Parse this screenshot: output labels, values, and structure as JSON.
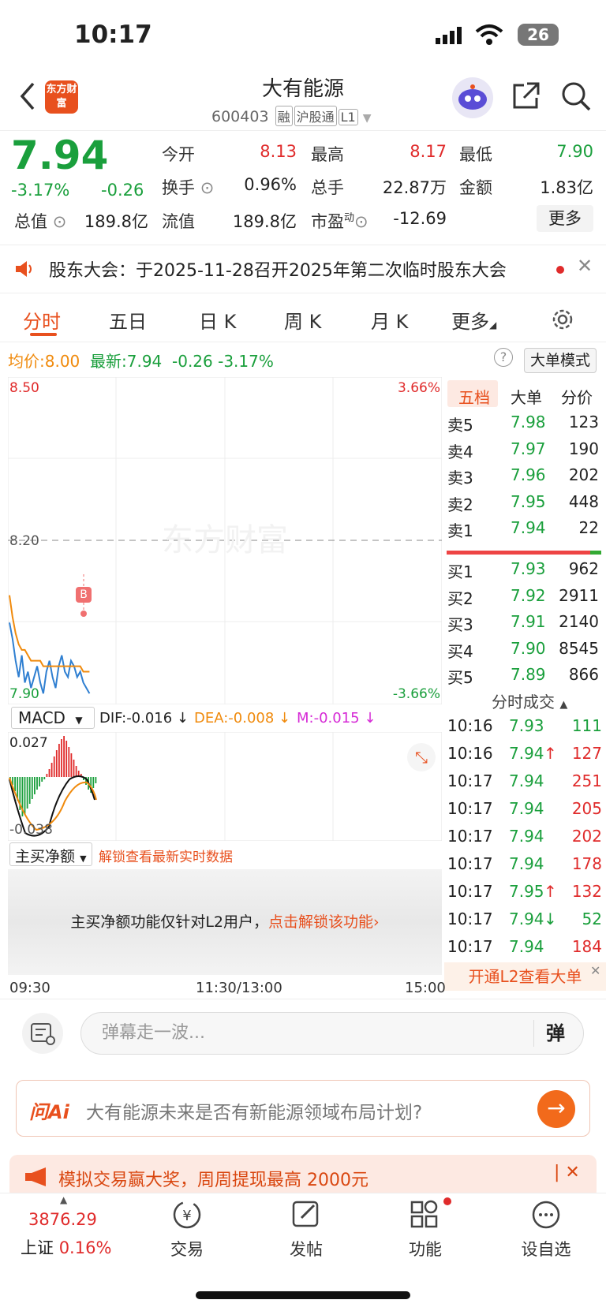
{
  "status": {
    "time": "10:17",
    "battery": "26"
  },
  "header": {
    "logo": "东方财富",
    "title": "大有能源",
    "code": "600403",
    "tags": [
      "融",
      "沪股通",
      "L1"
    ]
  },
  "quote": {
    "price": "7.94",
    "change_pct": "-3.17%",
    "change": "-0.26",
    "rows": [
      [
        {
          "l": "今开",
          "v": "8.13"
        },
        {
          "l": "最高",
          "v": "8.17"
        },
        {
          "l": "最低",
          "v": "7.90"
        }
      ],
      [
        {
          "l": "换手",
          "v": "0.96%"
        },
        {
          "l": "总手",
          "v": "22.87万"
        },
        {
          "l": "金额",
          "v": "1.83亿"
        }
      ],
      [
        {
          "l": "总值",
          "v": "189.8亿"
        },
        {
          "l": "流值",
          "v": "189.8亿"
        },
        {
          "l": "市盈",
          "v": "-12.69"
        }
      ]
    ],
    "pe_sup": "动",
    "more": "更多"
  },
  "notice": {
    "text": "股东大会：于2025-11-28召开2025年第二次临时股东大会"
  },
  "tabs": [
    "分时",
    "五日",
    "日 K",
    "周 K",
    "月 K",
    "更多"
  ],
  "info": {
    "avg_label": "均价:",
    "avg": "8.00",
    "latest_label": "最新:",
    "latest": "7.94",
    "chg": "-0.26",
    "pct": "-3.17%",
    "big_mode": "大单模式"
  },
  "chart": {
    "ymax": "8.50",
    "ymid": "8.20",
    "ymin": "7.90",
    "pmax": "3.66%",
    "pmin": "-3.66%",
    "watermark": "东方财富",
    "marker": "B",
    "times": [
      "09:30",
      "11:30/13:00",
      "15:00"
    ]
  },
  "chart_data": {
    "type": "line",
    "series": [
      {
        "values": [
          8.05,
          8.02,
          7.98,
          7.95,
          7.99,
          7.94,
          7.96,
          7.93,
          7.95,
          7.97,
          7.94,
          7.92,
          7.96,
          7.98,
          7.95,
          7.93,
          7.97,
          7.99,
          7.96,
          7.95,
          7.98,
          7.97,
          7.95,
          7.96,
          7.94,
          7.93,
          7.92
        ]
      },
      {
        "values": [
          8.1,
          8.06,
          8.03,
          8.01,
          8.0,
          8.0,
          7.99,
          7.98,
          7.98,
          7.98,
          7.98,
          7.97,
          7.97,
          7.97,
          7.97,
          7.97,
          7.97,
          7.97,
          7.97,
          7.97,
          7.97,
          7.97,
          7.97,
          7.97,
          7.96,
          7.96,
          7.96
        ]
      }
    ],
    "ylim": [
      7.9,
      8.5
    ]
  },
  "orderbook": {
    "tabs": [
      "五档",
      "大单",
      "分价"
    ],
    "sells": [
      [
        "卖5",
        "7.98",
        "123"
      ],
      [
        "卖4",
        "7.97",
        "190"
      ],
      [
        "卖3",
        "7.96",
        "202"
      ],
      [
        "卖2",
        "7.95",
        "448"
      ],
      [
        "卖1",
        "7.94",
        "22"
      ]
    ],
    "buys": [
      [
        "买1",
        "7.93",
        "962"
      ],
      [
        "买2",
        "7.92",
        "2911"
      ],
      [
        "买3",
        "7.91",
        "2140"
      ],
      [
        "买4",
        "7.90",
        "8545"
      ],
      [
        "买5",
        "7.89",
        "866"
      ]
    ]
  },
  "trades": {
    "title": "分时成交",
    "rows": [
      [
        "10:16",
        "7.93",
        "",
        "111"
      ],
      [
        "10:16",
        "7.94",
        "↑",
        "127"
      ],
      [
        "10:17",
        "7.94",
        "",
        "251"
      ],
      [
        "10:17",
        "7.94",
        "",
        "205"
      ],
      [
        "10:17",
        "7.94",
        "",
        "202"
      ],
      [
        "10:17",
        "7.94",
        "",
        "178"
      ],
      [
        "10:17",
        "7.95",
        "↑",
        "132"
      ],
      [
        "10:17",
        "7.94",
        "↓",
        "52"
      ],
      [
        "10:17",
        "7.94",
        "",
        "184"
      ]
    ],
    "l2": "开通L2查看大单"
  },
  "macd": {
    "sel": "MACD",
    "dif": "DIF:-0.016 ↓",
    "dea": "DEA:-0.008 ↓",
    "m": "M:-0.015 ↓",
    "top": "0.027",
    "bottom": "-0.038"
  },
  "mainbuy": {
    "sel": "主买净额",
    "unlock": "解锁查看最新实时数据",
    "msg": "主买净额功能仅针对L2用户，",
    "link": "点击解锁该功能›"
  },
  "comment": {
    "placeholder": "弹幕走一波...",
    "btn": "弹"
  },
  "ai": {
    "logo": "问Ai",
    "text": "大有能源未来是否有新能源领域布局计划?"
  },
  "promo": {
    "text": "模拟交易赢大奖，周周提现最高 2000元"
  },
  "nav": {
    "index_value": "3876.29",
    "index_name": "上证",
    "index_pct": "0.16%",
    "items": [
      "交易",
      "发帖",
      "功能",
      "设自选"
    ]
  }
}
